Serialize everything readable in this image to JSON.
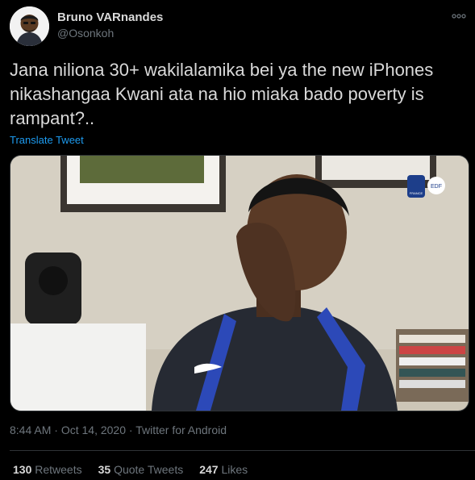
{
  "user": {
    "name": "Bruno VARnandes",
    "handle": "@Osonkoh"
  },
  "tweet": {
    "text": "Jana niliona 30+ wakilalamika bei ya the new iPhones nikashangaa Kwani ata na hio miaka bado poverty is rampant?..",
    "translate_label": "Translate Tweet"
  },
  "media": {
    "badge_text": "FRANCE",
    "logo_text": "EDF"
  },
  "meta": {
    "time": "8:44 AM",
    "separator": "·",
    "date": "Oct 14, 2020",
    "source": "Twitter for Android"
  },
  "stats": [
    {
      "count": "130",
      "label": "Retweets"
    },
    {
      "count": "35",
      "label": "Quote Tweets"
    },
    {
      "count": "247",
      "label": "Likes"
    }
  ],
  "icons": {
    "more": "more-options-icon"
  }
}
